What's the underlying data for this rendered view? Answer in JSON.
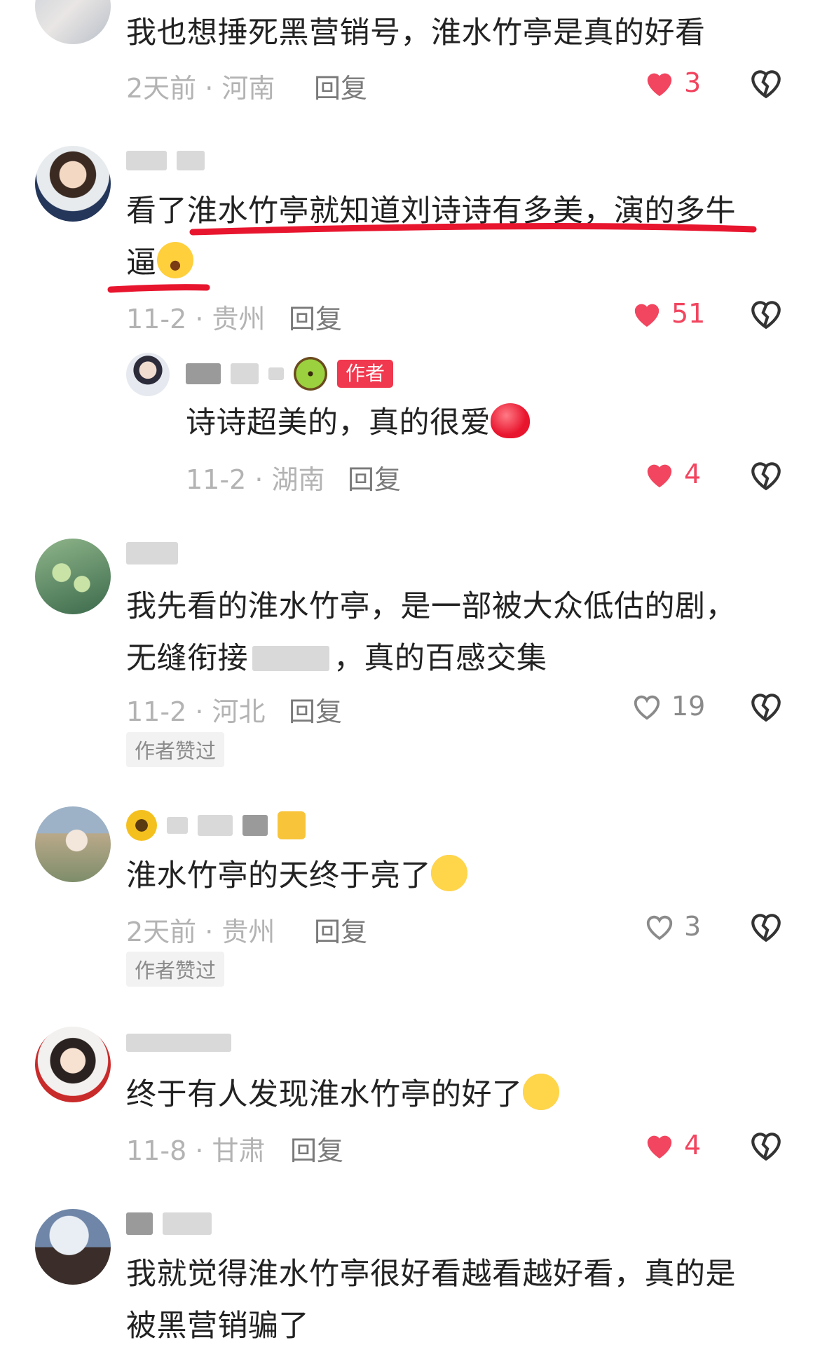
{
  "colors": {
    "like_red": "#f2455f",
    "author_badge": "#f0384e",
    "underline": "#e8152e"
  },
  "comments": [
    {
      "text": "我也想捶死黑营销号，淮水竹亭是真的好看",
      "meta": "2天前 · 河南",
      "reply": "回复",
      "likes": "3",
      "liked": true
    },
    {
      "text1": "看了淮水竹亭就知道刘诗诗有多美，演的多牛",
      "text2": "逼",
      "meta": "11-2 · 贵州",
      "reply": "回复",
      "likes": "51",
      "liked": true,
      "emoji": "crying-laughing-emoji"
    },
    {
      "author_badge": "作者",
      "text": "诗诗超美的，真的很爱",
      "meta": "11-2 · 湖南",
      "reply": "回复",
      "likes": "4",
      "liked": true,
      "emoji": "red-heart-emoji"
    },
    {
      "text1": "我先看的淮水竹亭，是一部被大众低估的剧，",
      "text2a": "无缝衔接",
      "text2b": "，真的百感交集",
      "meta": "11-2 · 河北",
      "reply": "回复",
      "likes": "19",
      "liked": false,
      "tag": "作者赞过"
    },
    {
      "text": "淮水竹亭的天终于亮了",
      "meta": "2天前 · 贵州",
      "reply": "回复",
      "likes": "3",
      "liked": false,
      "tag": "作者赞过",
      "emoji": "thinking-emoji"
    },
    {
      "text": "终于有人发现淮水竹亭的好了",
      "meta": "11-8 · 甘肃",
      "reply": "回复",
      "likes": "4",
      "liked": true,
      "emoji": "wink-kiss-emoji"
    },
    {
      "text1": "我就觉得淮水竹亭很好看越看越好看，真的是",
      "text2": "被黑营销骗了"
    }
  ]
}
